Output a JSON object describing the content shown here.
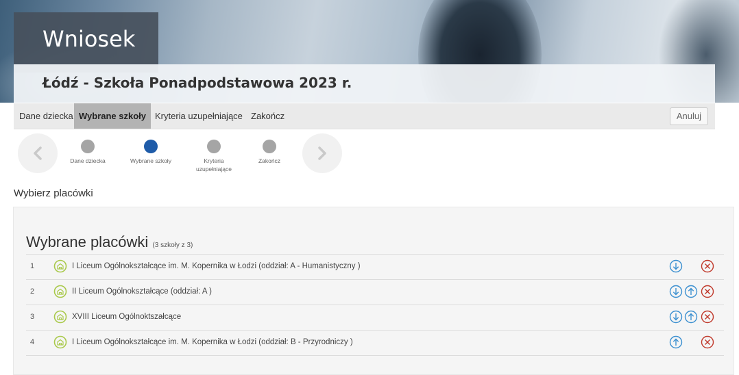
{
  "header": {
    "title": "Wniosek",
    "subtitle": "Łódź - Szkoła Ponadpodstawowa 2023 r."
  },
  "menu": {
    "items": [
      {
        "label": "Dane dziecka",
        "active": false
      },
      {
        "label": "Wybrane szkoły",
        "active": true
      },
      {
        "label": "Kryteria uzupełniające",
        "active": false
      },
      {
        "label": "Zakończ",
        "active": false
      }
    ],
    "cancel_label": "Anuluj"
  },
  "stepper": {
    "steps": [
      {
        "label": "Dane dziecka",
        "active": false
      },
      {
        "label": "Wybrane szkoły",
        "active": true
      },
      {
        "label": "Kryteria uzupełniające",
        "active": false
      },
      {
        "label": "Zakończ",
        "active": false
      }
    ],
    "prev_icon": "chevron-left-icon",
    "next_icon": "chevron-right-icon"
  },
  "section": {
    "heading": "Wybierz placówki"
  },
  "panel": {
    "title": "Wybrane placówki",
    "count": "(3 szkoły z 3)",
    "rows": [
      {
        "num": "1",
        "name": "I Liceum Ogólnokształcące im. M. Kopernika w Łodzi (oddział: A - Humanistyczny )",
        "down": true,
        "up": false,
        "remove": true
      },
      {
        "num": "2",
        "name": "II Liceum Ogólnokształcące (oddział: A )",
        "down": true,
        "up": true,
        "remove": true
      },
      {
        "num": "3",
        "name": "XVIII Liceum Ogólnoktszałcące",
        "down": true,
        "up": true,
        "remove": true
      },
      {
        "num": "4",
        "name": "I Liceum Ogólnokształcące im. M. Kopernika w Łodzi (oddział: B - Przyrodniczy )",
        "down": false,
        "up": true,
        "remove": true
      }
    ]
  },
  "colors": {
    "accent_blue": "#1f5ca9",
    "icon_blue": "#3a8fd0",
    "icon_red": "#c0392b",
    "school_icon": "#a9c94a"
  }
}
